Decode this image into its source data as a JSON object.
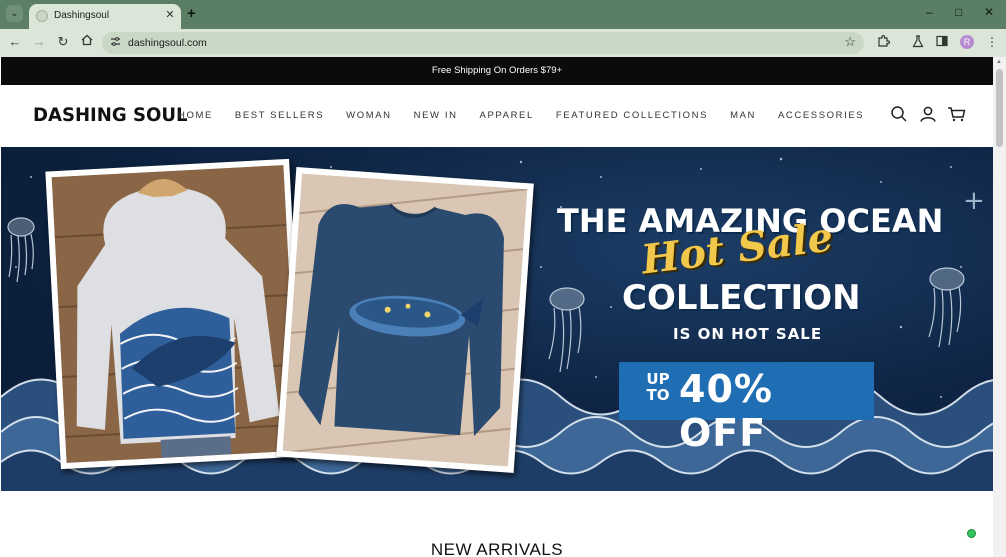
{
  "browser": {
    "tab_title": "Dashingsoul",
    "url": "dashingsoul.com",
    "profile_initial": "R",
    "icons": {
      "tab_search": "chevron-down-icon",
      "tab_close": "close-icon",
      "new_tab": "plus-icon",
      "back": "arrow-left-icon",
      "forward": "arrow-right-icon",
      "reload": "reload-icon",
      "home": "home-icon",
      "site_info": "site-info-icon",
      "bookmark": "star-icon",
      "extensions": "puzzle-icon",
      "labs": "flask-icon",
      "sidebar": "sidebar-icon",
      "menu": "kebab-menu-icon"
    }
  },
  "site": {
    "announcement": "Free Shipping On Orders $79+",
    "logo": "DASHING SOUL",
    "nav": [
      "HOME",
      "BEST SELLERS",
      "WOMAN",
      "NEW IN",
      "APPAREL",
      "FEATURED COLLECTIONS",
      "MAN",
      "ACCESSORIES"
    ],
    "header_icons": [
      "search-icon",
      "account-icon",
      "cart-icon"
    ]
  },
  "banner": {
    "line1": "THE AMAZING OCEAN",
    "script": "Hot Sale",
    "line2": "COLLECTION",
    "line3": "IS ON HOT SALE",
    "offer_prefix": "UP TO",
    "offer_main": "40% OFF",
    "colors": {
      "background": "#0f2545",
      "offer_box": "#1f6db3",
      "script": "#f1c84b"
    }
  },
  "section_heading": "NEW ARRIVALS",
  "chat_status_color": "#35c35c"
}
